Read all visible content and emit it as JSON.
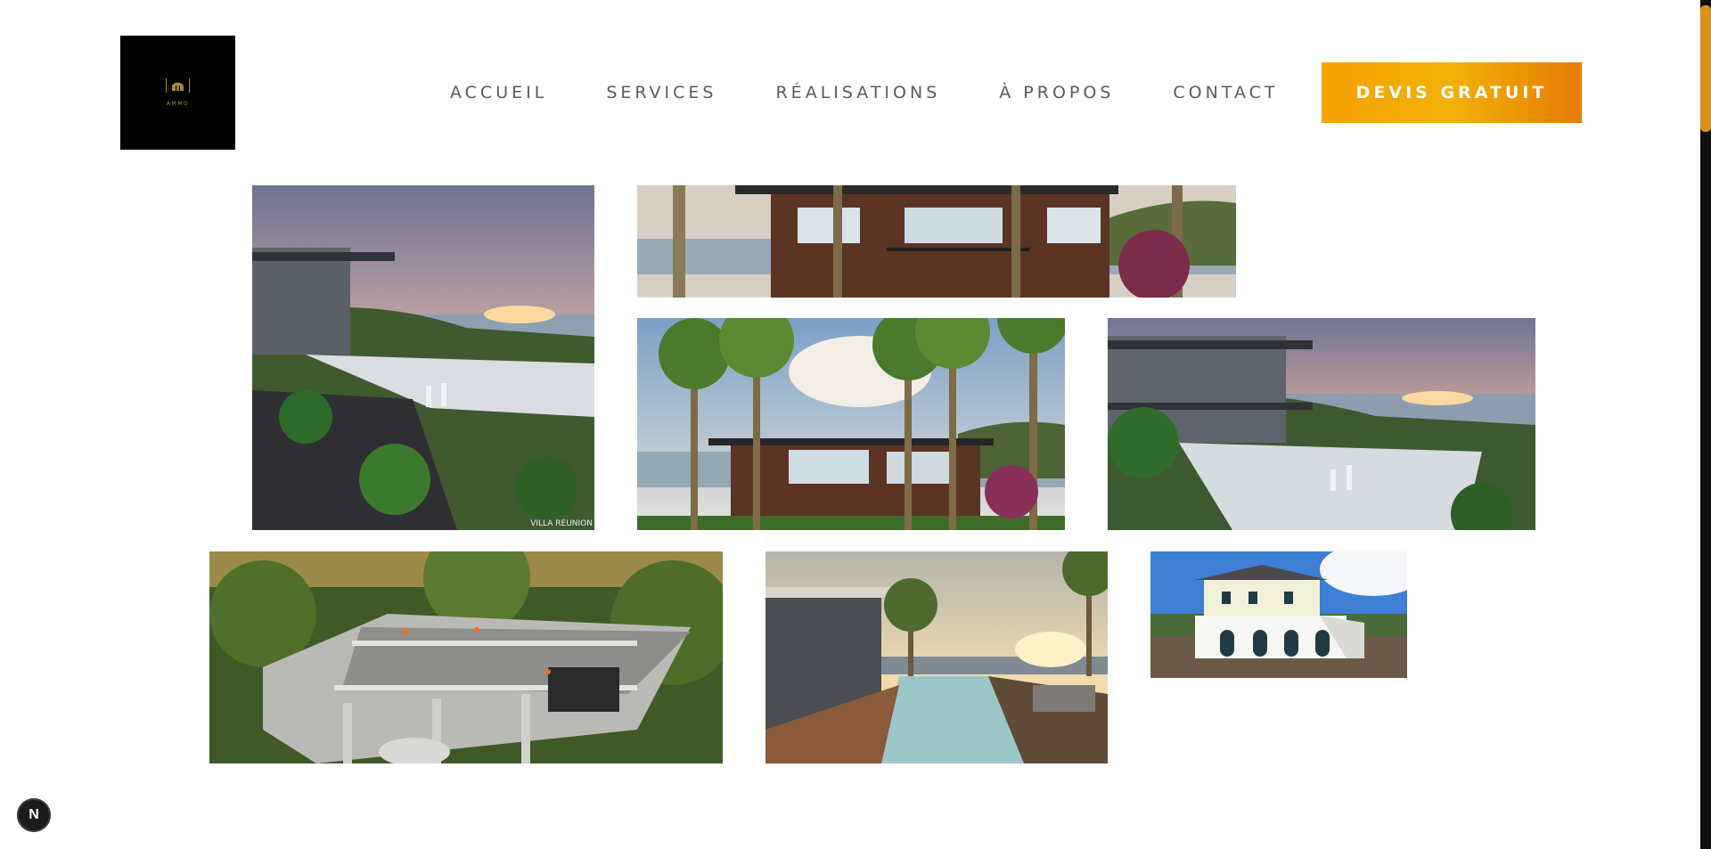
{
  "brand": {
    "logo_text": "AMMO"
  },
  "nav": {
    "items": [
      "ACCUEIL",
      "SERVICES",
      "RÉALISATIONS",
      "À PROPOS",
      "CONTACT"
    ]
  },
  "cta": {
    "label": "DEVIS GRATUIT"
  },
  "gallery": {
    "watermark": "VILLA RÉUNION",
    "images": [
      "villa-infinity-pool-sunset",
      "modern-villa-palm-trees-wide",
      "modern-villa-palm-trees",
      "villa-terrace-sunset-coast",
      "construction-site-aerial",
      "pool-deck-sunset",
      "creole-house-under-construction"
    ]
  },
  "badge": {
    "label": "N"
  },
  "colors": {
    "accent": "#f2a104",
    "accent_dark": "#e77b06",
    "logo_gold": "#b08a3c"
  }
}
